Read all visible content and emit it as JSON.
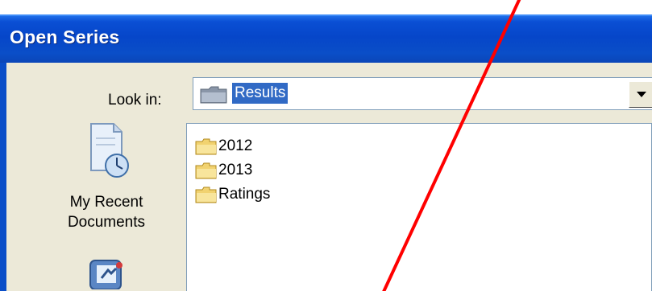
{
  "window": {
    "title": "Open Series"
  },
  "look_in": {
    "label": "Look in:",
    "value": "Results"
  },
  "places": [
    {
      "label_line1": "My Recent",
      "label_line2": "Documents",
      "icon": "recent-documents-icon"
    },
    {
      "label_line1": "",
      "label_line2": "",
      "icon": "desktop-icon"
    }
  ],
  "files": [
    {
      "name": "2012",
      "icon": "folder-icon"
    },
    {
      "name": "2013",
      "icon": "folder-icon"
    },
    {
      "name": "Ratings",
      "icon": "folder-icon"
    }
  ],
  "colors": {
    "title_bar": "#0a4ec8",
    "dialog_bg": "#ece9d8",
    "selection": "#316ac5",
    "annotation_line": "#ff0000"
  }
}
